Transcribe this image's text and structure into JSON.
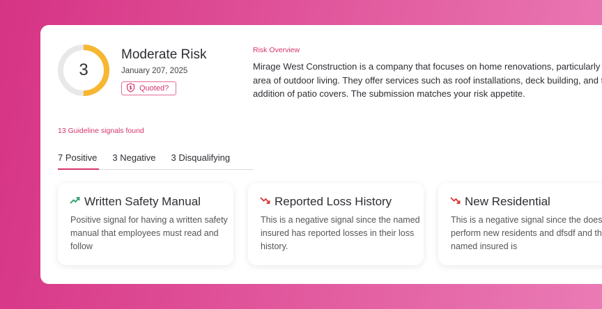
{
  "risk": {
    "score": "3",
    "score_fraction": 0.5,
    "level": "Moderate Risk",
    "date": "January 207, 2025",
    "quoted_label": "Quoted?"
  },
  "overview": {
    "label": "Risk Overview",
    "text": "Mirage West Construction is a company that focuses on home renovations, particularly in the area of outdoor living. They offer services such as roof installations, deck building, and the addition of patio covers. The submission matches your risk appetite."
  },
  "signals_count": "13 Guideline signals found",
  "tabs": [
    {
      "label": "7 Positive",
      "active": true
    },
    {
      "label": "3 Negative",
      "active": false
    },
    {
      "label": "3 Disqualifying",
      "active": false
    }
  ],
  "signals": [
    {
      "title": "Written Safety Manual",
      "type": "positive",
      "icon": "trend-up-icon",
      "body": "Positive signal for having a written safety manual that employees must read and follow"
    },
    {
      "title": "Reported Loss History",
      "type": "negative",
      "icon": "trend-down-icon",
      "body": "This is a negative signal since the named insured has reported losses in their loss history."
    },
    {
      "title": "New Residential",
      "type": "negative",
      "icon": "trend-down-icon",
      "body": "This is a negative signal since the does perform new residents and dfsdf and the named insured is"
    }
  ],
  "colors": {
    "accent": "#d6336c",
    "gauge": "#f7b731",
    "gauge_track": "#e8e8e8",
    "positive": "#2a9d6a",
    "negative": "#d63333"
  }
}
